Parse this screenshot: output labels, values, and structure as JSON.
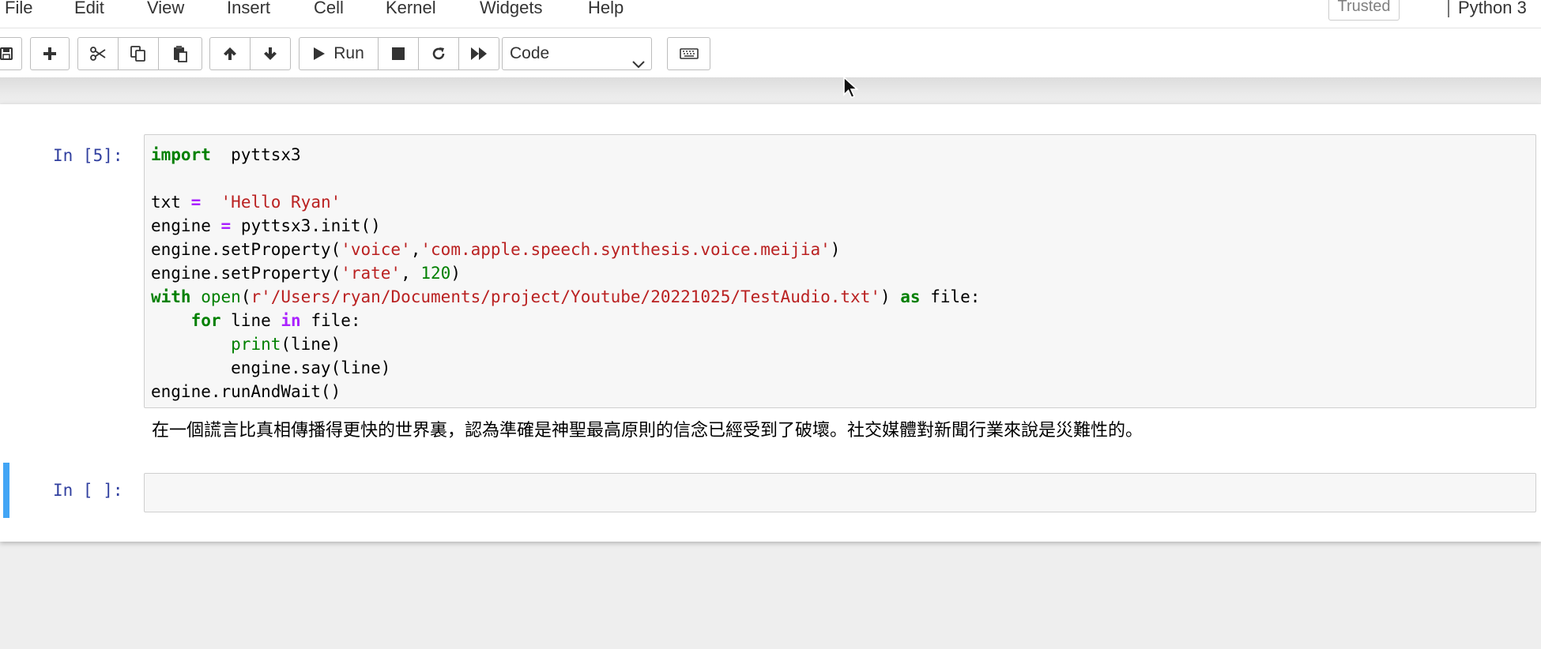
{
  "menu": {
    "items": [
      "File",
      "Edit",
      "View",
      "Insert",
      "Cell",
      "Kernel",
      "Widgets",
      "Help"
    ],
    "trusted": "Trusted",
    "kernel": "Python 3"
  },
  "toolbar": {
    "run_label": "Run",
    "cell_type": "Code",
    "buttons": [
      "save-icon",
      "plus-icon",
      "scissors-icon",
      "copy-icon",
      "paste-icon",
      "arrow-up-icon",
      "arrow-down-icon",
      "play-icon",
      "stop-icon",
      "restart-icon",
      "fast-forward-icon",
      "keyboard-icon"
    ]
  },
  "cells": [
    {
      "prompt": "In [5]:",
      "code_lines": [
        [
          [
            "kw",
            "import"
          ],
          [
            "",
            "  pyttsx3"
          ]
        ],
        [],
        [
          [
            "",
            "txt "
          ],
          [
            "op",
            "="
          ],
          [
            "",
            "  "
          ],
          [
            "str",
            "'Hello Ryan'"
          ]
        ],
        [
          [
            "",
            "engine "
          ],
          [
            "op",
            "="
          ],
          [
            "",
            "",
            " pyttsx3.init()"
          ]
        ],
        [
          [
            "",
            "engine.setProperty("
          ],
          [
            "str",
            "'voice'"
          ],
          [
            "",
            ","
          ],
          [
            "str",
            "'com.apple.speech.synthesis.voice.meijia'"
          ],
          [
            "",
            ")"
          ]
        ],
        [
          [
            "",
            "engine.setProperty("
          ],
          [
            "str",
            "'rate'"
          ],
          [
            "",
            ", "
          ],
          [
            "num",
            "120"
          ],
          [
            "",
            ")"
          ]
        ],
        [
          [
            "kw",
            "with"
          ],
          [
            "",
            "",
            " "
          ],
          [
            "bi",
            "open"
          ],
          [
            "",
            "("
          ],
          [
            "str",
            "r'/Users/ryan/Documents/project/Youtube/20221025/TestAudio.txt'"
          ],
          [
            "",
            ") "
          ],
          [
            "kw",
            "as"
          ],
          [
            "",
            "",
            " file:"
          ]
        ],
        [
          [
            "",
            "    "
          ],
          [
            "kw",
            "for"
          ],
          [
            "",
            "",
            " line "
          ],
          [
            "op",
            "in"
          ],
          [
            "",
            "",
            " file:"
          ]
        ],
        [
          [
            "",
            "        "
          ],
          [
            "bi",
            "print"
          ],
          [
            "",
            "(line)"
          ]
        ],
        [
          [
            "",
            "        engine.say(line)"
          ]
        ],
        [
          [
            "",
            "engine.runAndWait()"
          ]
        ]
      ],
      "output": "在一個謊言比真相傳播得更快的世界裏，認為準確是神聖最高原則的信念已經受到了破壞。社交媒體對新聞行業來說是災難性的。"
    },
    {
      "prompt": "In [ ]:",
      "code_lines": []
    }
  ],
  "colors": {
    "keyword": "#008000",
    "operator": "#aa22ff",
    "string": "#ba2121",
    "prompt": "#303f9f",
    "selected_cell_bar": "#42a5f5"
  }
}
